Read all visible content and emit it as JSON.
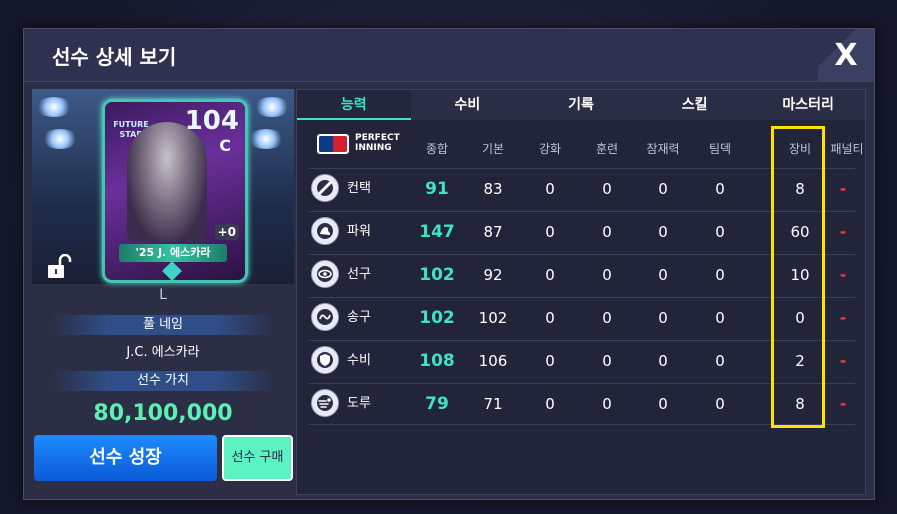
{
  "dialog": {
    "title": "선수 상세 보기",
    "close_label": "X"
  },
  "card": {
    "ovr": "104",
    "grade": "C",
    "badge": "FUTURE STAR",
    "plus": "+0",
    "name": "'25 J. 에스카라"
  },
  "player": {
    "position": "L",
    "full_name_label": "풀 네임",
    "full_name": "J.C. 에스카라",
    "value_label": "선수 가치",
    "value": "80,100,000"
  },
  "buttons": {
    "grow": "선수 성장",
    "buy": "선수 구매"
  },
  "tabs": [
    {
      "label": "능력",
      "active": true
    },
    {
      "label": "수비",
      "active": false
    },
    {
      "label": "기록",
      "active": false
    },
    {
      "label": "스킬",
      "active": false
    },
    {
      "label": "마스터리",
      "active": false
    }
  ],
  "logo": {
    "line1": "PERFECT",
    "line2": "INNING"
  },
  "columns": [
    "종합",
    "기본",
    "강화",
    "훈련",
    "잠재력",
    "팀덱",
    "장비",
    "패널티"
  ],
  "rows": [
    {
      "stat": "컨택",
      "icon": "bat-icon",
      "values": [
        "91",
        "83",
        "0",
        "0",
        "0",
        "0",
        "8",
        "-"
      ]
    },
    {
      "stat": "파워",
      "icon": "muscle-icon",
      "values": [
        "147",
        "87",
        "0",
        "0",
        "0",
        "0",
        "60",
        "-"
      ]
    },
    {
      "stat": "선구",
      "icon": "eye-icon",
      "values": [
        "102",
        "92",
        "0",
        "0",
        "0",
        "0",
        "10",
        "-"
      ]
    },
    {
      "stat": "송구",
      "icon": "throw-icon",
      "values": [
        "102",
        "102",
        "0",
        "0",
        "0",
        "0",
        "0",
        "-"
      ]
    },
    {
      "stat": "수비",
      "icon": "shield-icon",
      "values": [
        "108",
        "106",
        "0",
        "0",
        "0",
        "0",
        "2",
        "-"
      ]
    },
    {
      "stat": "도루",
      "icon": "run-icon",
      "values": [
        "79",
        "71",
        "0",
        "0",
        "0",
        "0",
        "8",
        "-"
      ]
    }
  ],
  "colors": {
    "accent": "#3fe2c4",
    "highlight": "#ffe100",
    "penalty": "#ff3b3b",
    "price": "#5cf0b5"
  }
}
